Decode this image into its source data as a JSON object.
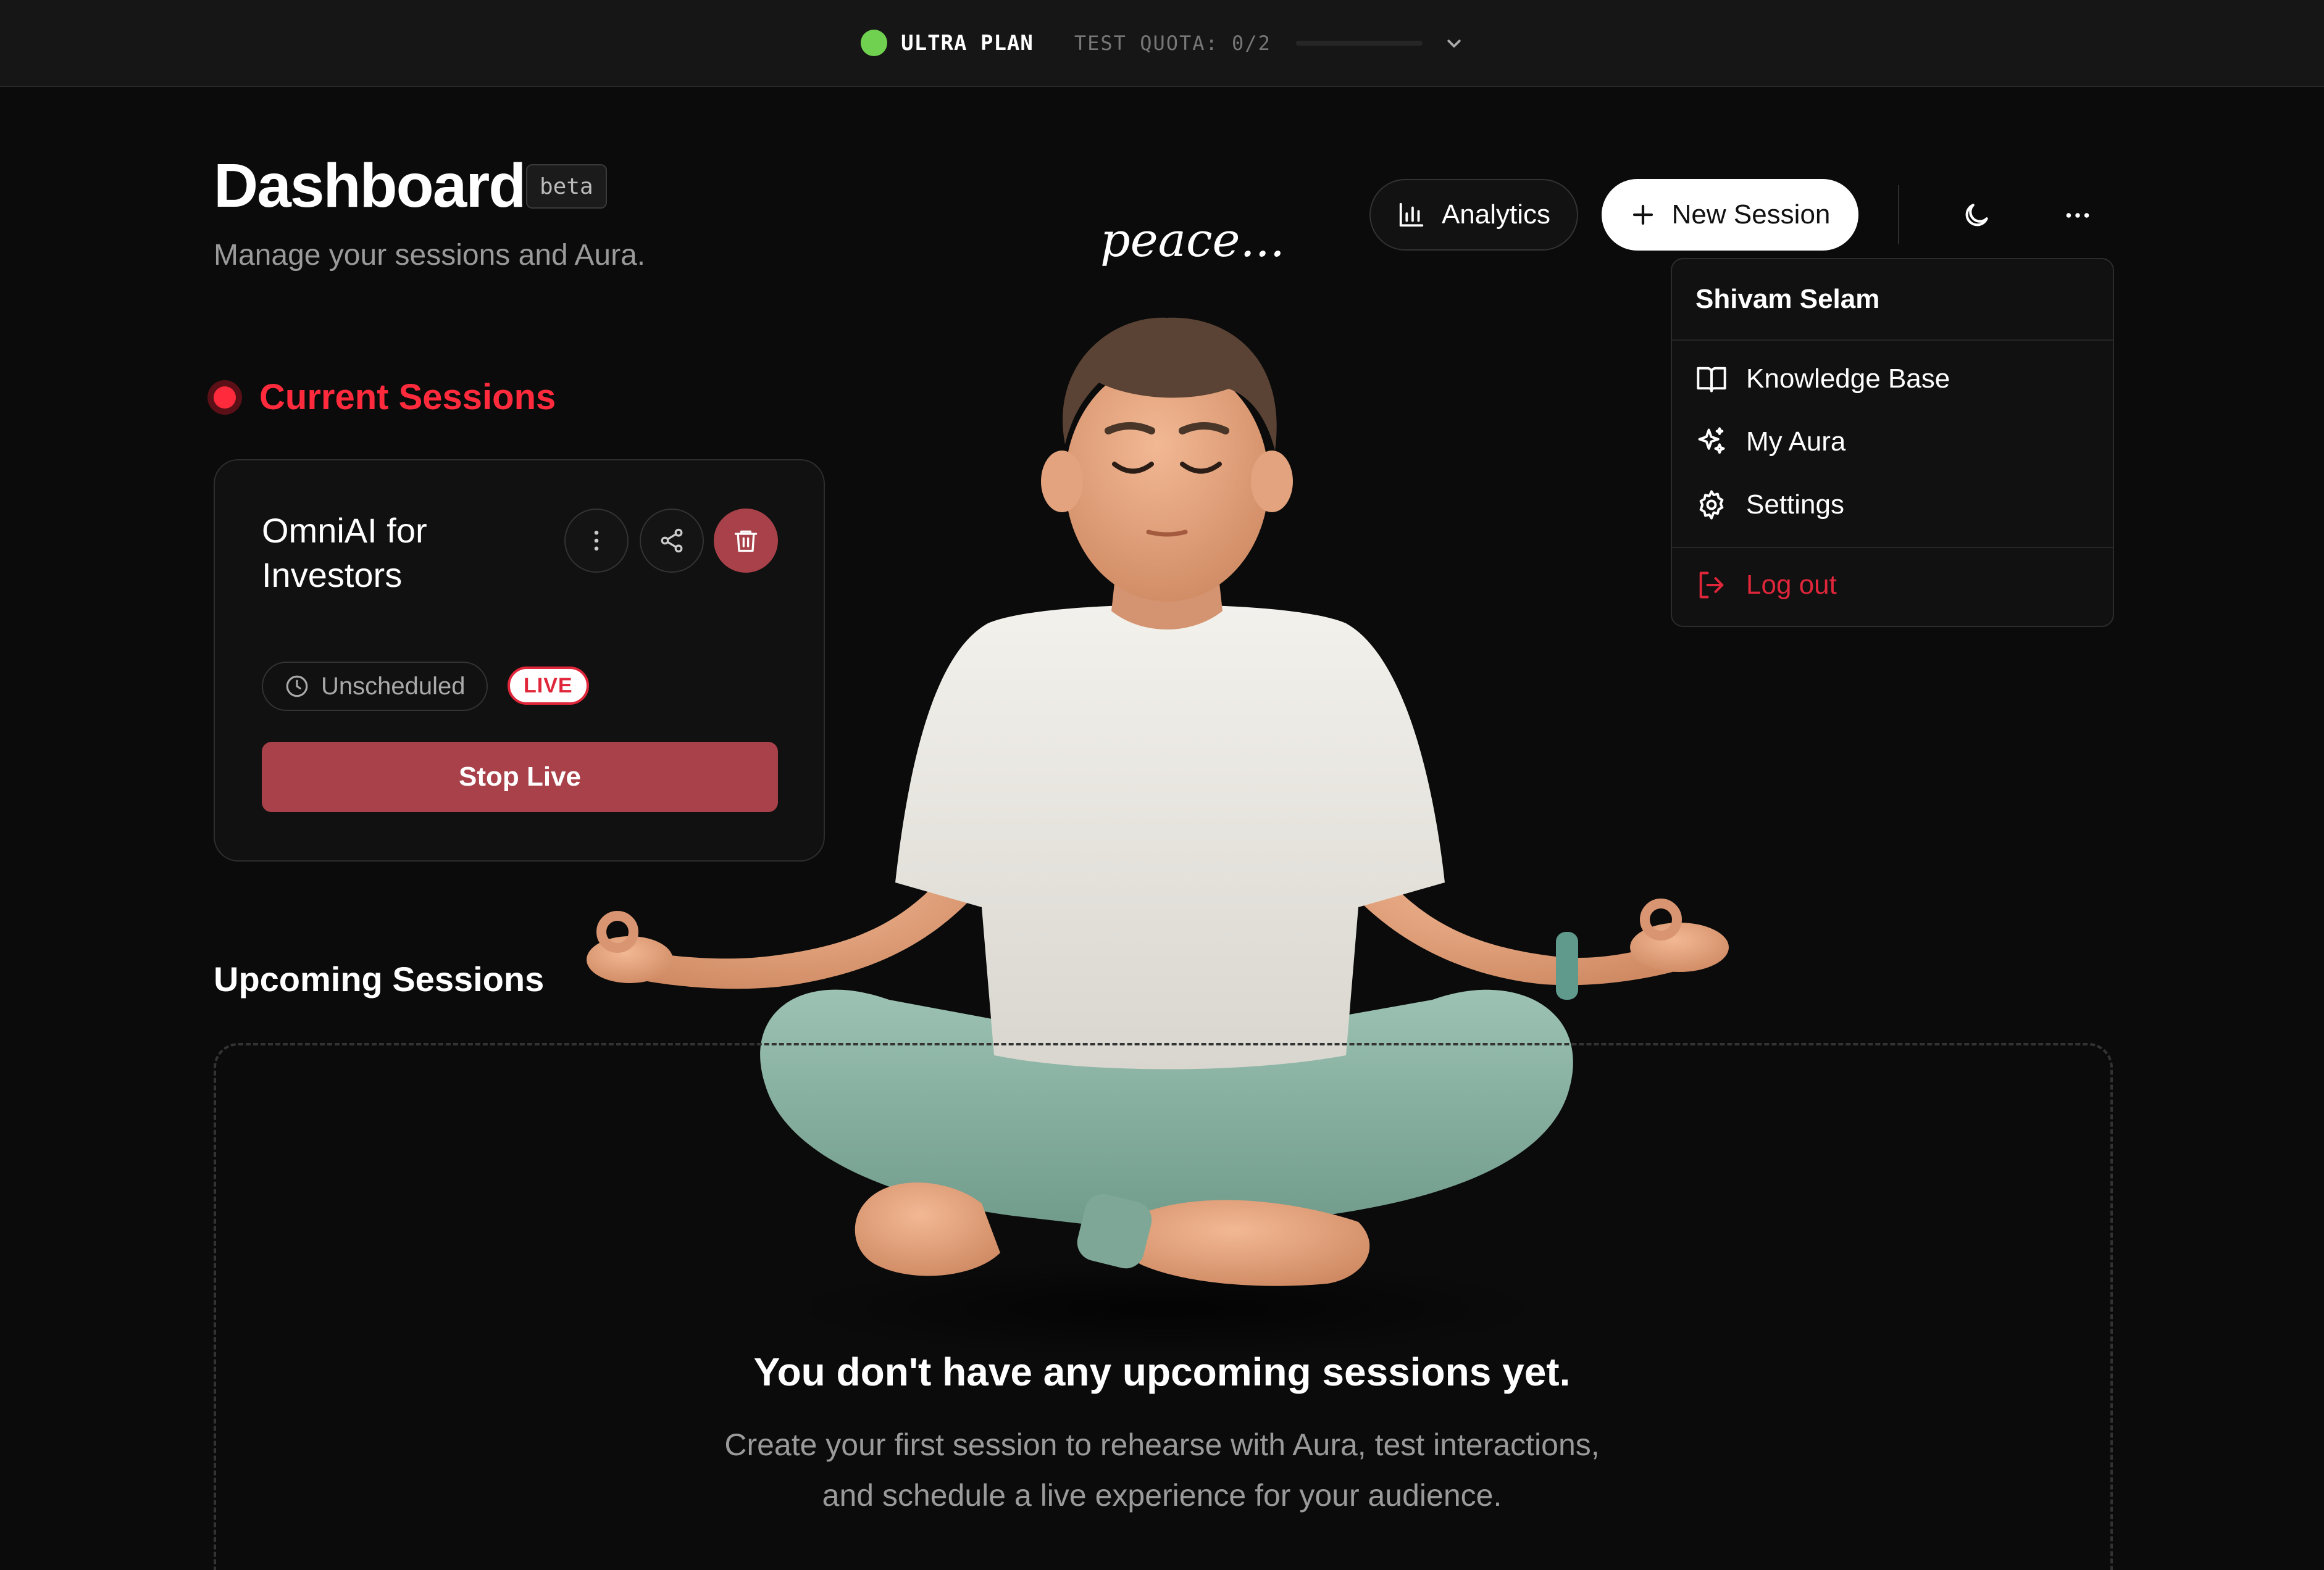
{
  "topbar": {
    "plan_label": "ULTRA PLAN",
    "quota_label": "TEST QUOTA: 0/2",
    "quota_used": 0,
    "quota_total": 2,
    "plan_color": "#6fd14f"
  },
  "header": {
    "title": "Dashboard",
    "badge": "beta",
    "subtitle": "Manage your sessions and Aura.",
    "analytics_label": "Analytics",
    "new_session_label": "New Session"
  },
  "menu": {
    "user_name": "Shivam Selam",
    "items": [
      {
        "label": "Knowledge Base",
        "icon": "book-icon"
      },
      {
        "label": "My Aura",
        "icon": "sparkles-icon"
      },
      {
        "label": "Settings",
        "icon": "gear-icon"
      }
    ],
    "logout_label": "Log out"
  },
  "hero": {
    "caption": "peace..."
  },
  "current": {
    "heading": "Current Sessions",
    "session": {
      "name": "OmniAI for Investors",
      "schedule": "Unscheduled",
      "status": "LIVE",
      "stop_label": "Stop Live"
    }
  },
  "upcoming": {
    "heading": "Upcoming Sessions",
    "empty_title": "You don't have any upcoming sessions yet.",
    "empty_text": "Create your first session to rehearse with Aura, test interactions, and schedule a live experience for your audience."
  },
  "colors": {
    "accent_red": "#ff2b3d",
    "danger": "#a84149",
    "background": "#0b0b0b"
  }
}
